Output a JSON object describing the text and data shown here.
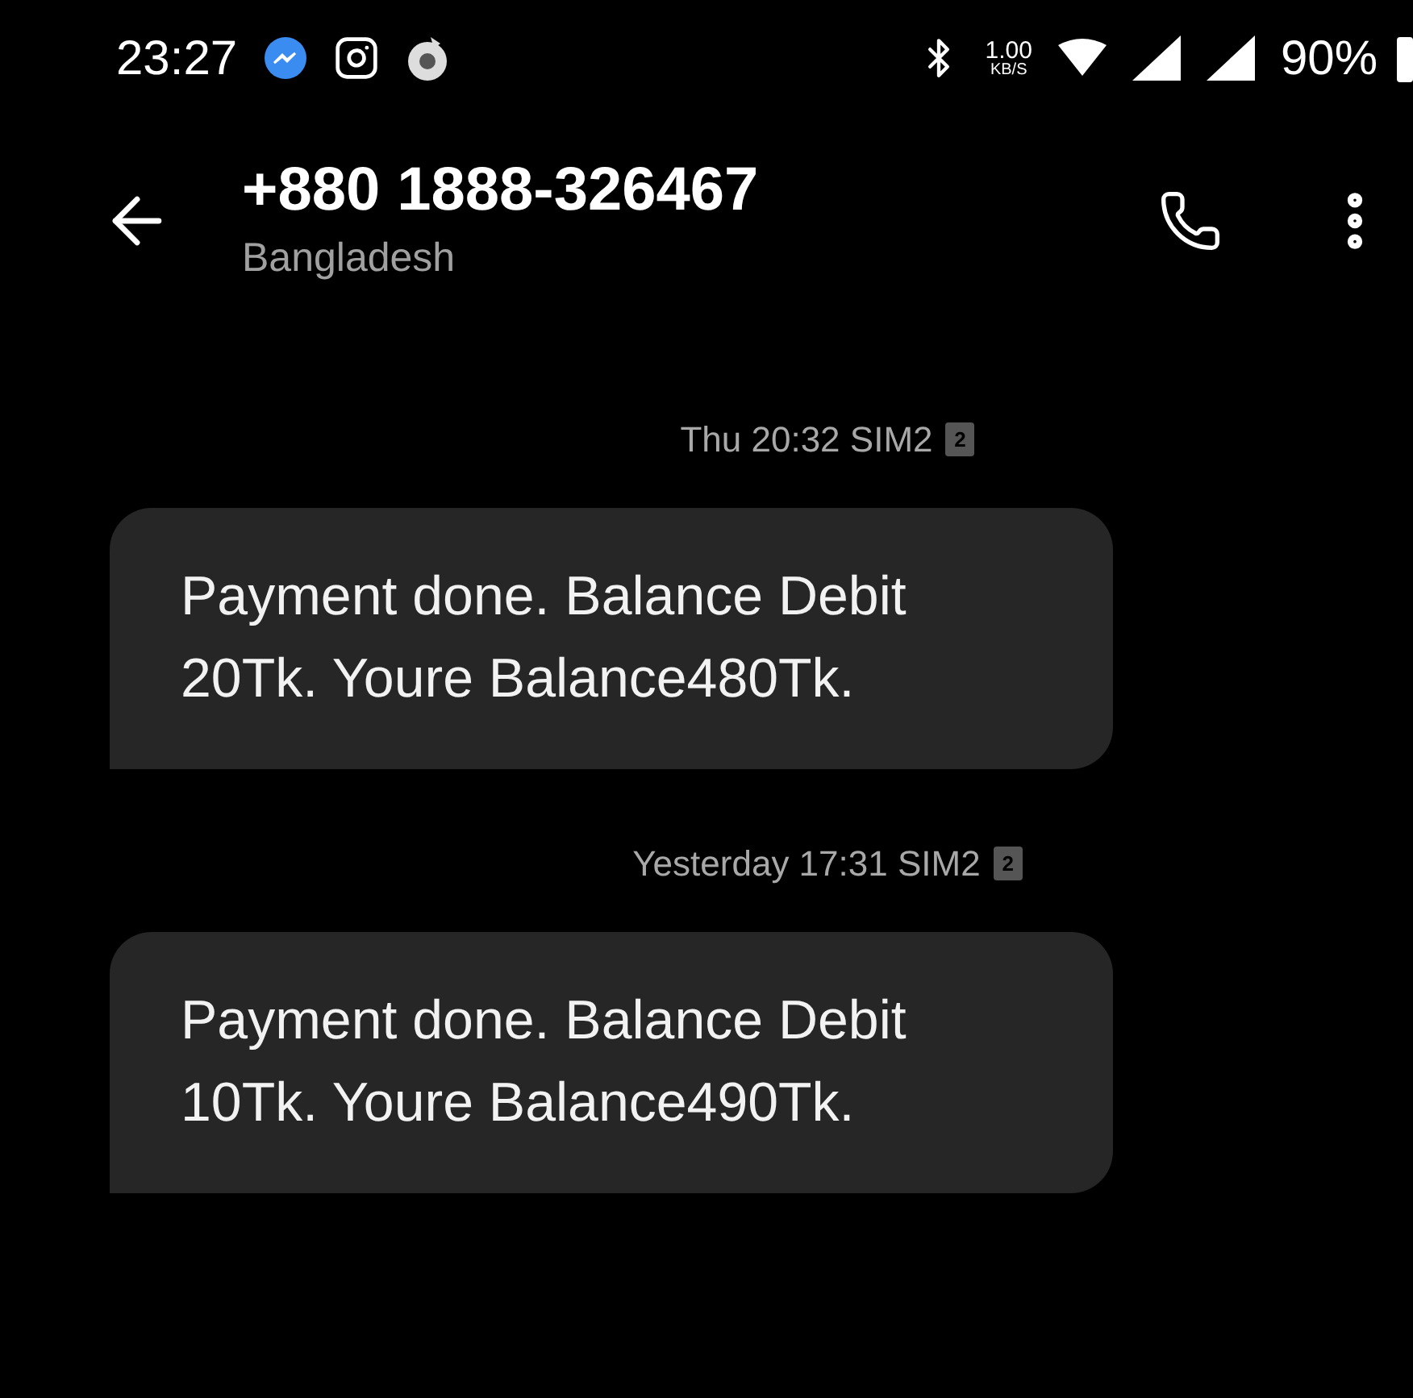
{
  "status_bar": {
    "time": "23:27",
    "net_speed": "1.00",
    "net_unit": "KB/S",
    "battery": "90%"
  },
  "header": {
    "title": "+880 1888-326467",
    "subtitle": "Bangladesh"
  },
  "messages": [
    {
      "timestamp": "Thu 20:32 SIM2",
      "sim": "2",
      "text": "Payment done. Balance Debit 20Tk. Youre Balance480Tk."
    },
    {
      "timestamp": "Yesterday 17:31 SIM2",
      "sim": "2",
      "text": "Payment done. Balance Debit 10Tk. Youre Balance490Tk."
    }
  ]
}
